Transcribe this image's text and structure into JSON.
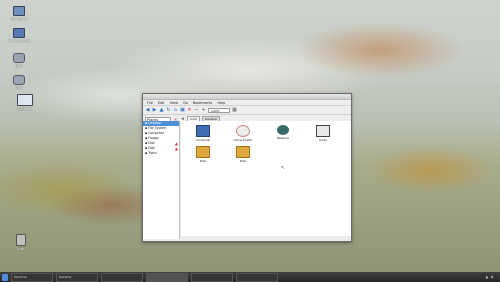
{
  "desktop": {
    "icons": [
      {
        "label": "Computer",
        "color": "#6e8fbf"
      },
      {
        "label": "Home Folder",
        "color": "#5779b3"
      },
      {
        "label": "Disk",
        "color": "#9aa4b0"
      },
      {
        "label": "Disk",
        "color": "#9aa4b0"
      },
      {
        "label": "Network",
        "color": "#7c8fb0"
      },
      {
        "label": "Trash",
        "color": "#c0c0c0"
      }
    ]
  },
  "window": {
    "menu": [
      "File",
      "Edit",
      "View",
      "Go",
      "Bookmarks",
      "Help"
    ],
    "zoom_value": "100%",
    "places_label": "Places",
    "path": [
      "mint",
      "Desktop"
    ],
    "sidebar": [
      {
        "label": "Desktop",
        "selected": true
      },
      {
        "label": "File System",
        "selected": false
      },
      {
        "label": "Computer",
        "selected": false
      },
      {
        "label": "Floppy",
        "selected": false
      },
      {
        "label": "Disk",
        "selected": false,
        "eject": true
      },
      {
        "label": "Disk",
        "selected": false,
        "eject": true
      },
      {
        "label": "Trash",
        "selected": false
      }
    ],
    "files": [
      {
        "label": "Computer",
        "icon": "computer-icon"
      },
      {
        "label": "Home Folder",
        "icon": "home-folder-icon"
      },
      {
        "label": "Network",
        "icon": "network-icon"
      },
      {
        "label": "Trash",
        "icon": "trash-icon"
      },
      {
        "label": "Disk",
        "icon": "disk-icon"
      },
      {
        "label": "Disk",
        "icon": "disk-icon"
      }
    ],
    "status": ""
  },
  "panel": {
    "tasks": [
      "Terminal",
      "Desktop",
      "",
      "",
      "",
      ""
    ],
    "clock": "",
    "accent": "#4d8fd8"
  }
}
